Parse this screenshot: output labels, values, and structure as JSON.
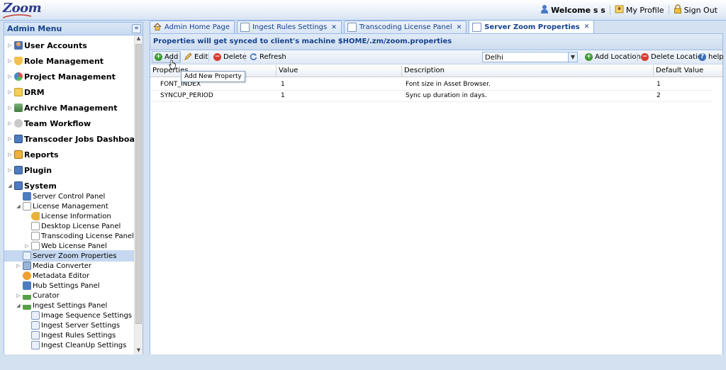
{
  "header": {
    "logo_text": "Zoom",
    "welcome": "Welcome s s",
    "my_profile": "My Profile",
    "sign_out": "Sign Out"
  },
  "sidebar": {
    "title": "Admin Menu",
    "collapse_icon": "«",
    "items": [
      {
        "label": "User Accounts",
        "icon": "user-icon"
      },
      {
        "label": "Role Management",
        "icon": "shield-icon"
      },
      {
        "label": "Project Management",
        "icon": "pie-icon"
      },
      {
        "label": "DRM",
        "icon": "folder-icon"
      },
      {
        "label": "Archive Management",
        "icon": "archive-icon"
      },
      {
        "label": "Team Workflow",
        "icon": "workflow-icon"
      },
      {
        "label": "Transcoder Jobs Dashboard",
        "icon": "monitor-icon"
      },
      {
        "label": "Reports",
        "icon": "report-icon"
      },
      {
        "label": "Plugin",
        "icon": "monitor-icon"
      },
      {
        "label": "System",
        "icon": "monitor-icon"
      }
    ],
    "system_children": [
      {
        "label": "Server Control Panel"
      },
      {
        "label": "License Management"
      },
      {
        "label": "License Information"
      },
      {
        "label": "Desktop License Panel"
      },
      {
        "label": "Transcoding License Panel"
      },
      {
        "label": "Web License Panel"
      },
      {
        "label": "Server Zoom Properties"
      },
      {
        "label": "Media Converter"
      },
      {
        "label": "Metadata Editor"
      },
      {
        "label": "Hub Settings Panel"
      },
      {
        "label": "Curator"
      },
      {
        "label": "Ingest Settings Panel"
      },
      {
        "label": "Image Sequence Settings"
      },
      {
        "label": "Ingest Server Settings"
      },
      {
        "label": "Ingest Rules Settings"
      },
      {
        "label": "Ingest CleanUp Settings"
      }
    ]
  },
  "tabs": [
    {
      "label": "Admin Home Page",
      "closable": false
    },
    {
      "label": "Ingest Rules Settings",
      "closable": true
    },
    {
      "label": "Transcoding License Panel",
      "closable": true
    },
    {
      "label": "Server Zoom Properties",
      "closable": true,
      "active": true
    }
  ],
  "main": {
    "title": "Properties will get synced to client's machine $HOME/.zm/zoom.properties",
    "toolbar": {
      "add": "Add",
      "edit": "Edit",
      "delete": "Delete",
      "refresh": "Refresh",
      "location_value": "Delhi",
      "add_location": "Add Location",
      "delete_location": "Delete Location",
      "help": "help"
    },
    "tooltip": "Add New Property",
    "columns": [
      "Properties",
      "Value",
      "Description",
      "Default Value"
    ],
    "rows": [
      {
        "property": "FONT_INDEX",
        "value": "1",
        "description": "Font size in Asset Browser.",
        "default": "1"
      },
      {
        "property": "SYNCUP_PERIOD",
        "value": "1",
        "description": "Sync up duration in days.",
        "default": "2"
      }
    ]
  }
}
